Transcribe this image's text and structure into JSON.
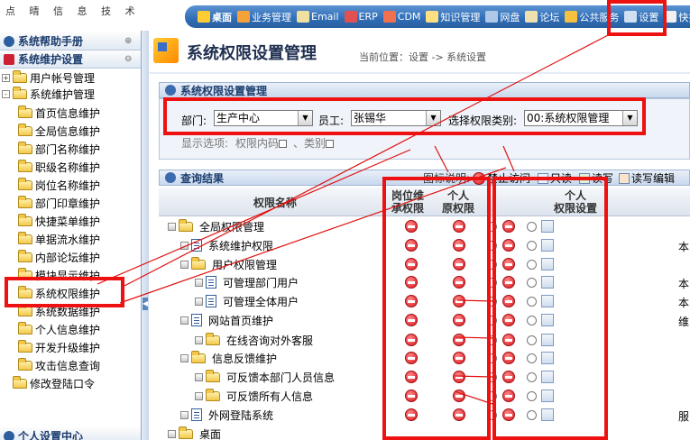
{
  "app": {
    "logo_text": "点 晴 信 息 技 术"
  },
  "menu": [
    {
      "label": "桌面",
      "icon": "desktop-icon",
      "color": "#ffcc33",
      "bold": true
    },
    {
      "label": "业务管理",
      "icon": "business-icon",
      "color": "#f6a23a"
    },
    {
      "label": "Email",
      "icon": "email-icon",
      "color": "#f0e0a0"
    },
    {
      "label": "ERP",
      "icon": "erp-icon",
      "color": "#e05050"
    },
    {
      "label": "CDM",
      "icon": "cdm-icon",
      "color": "#f07050"
    },
    {
      "label": "知识管理",
      "icon": "knowledge-icon",
      "color": "#ffe080"
    },
    {
      "label": "网盘",
      "icon": "netdisk-icon",
      "color": "#b0c8e8"
    },
    {
      "label": "论坛",
      "icon": "forum-icon",
      "color": "#f0e0b0"
    },
    {
      "label": "公共服务",
      "icon": "public-service-icon",
      "color": "#f6c040"
    },
    {
      "label": "设置",
      "icon": "settings-icon",
      "color": "#d0e0f0"
    },
    {
      "label": "快捷",
      "icon": "shortcut-icon",
      "color": "#f0f0f0"
    }
  ],
  "sidebar": {
    "sections": [
      "系统帮助手册",
      "系统维护设置",
      "个人设置中心"
    ],
    "tree": [
      {
        "label": "用户帐号管理",
        "level": 0,
        "expander": "+"
      },
      {
        "label": "系统维护管理",
        "level": 0,
        "expander": "-"
      },
      {
        "label": "首页信息维护",
        "level": 1
      },
      {
        "label": "全局信息维护",
        "level": 1
      },
      {
        "label": "部门名称维护",
        "level": 1
      },
      {
        "label": "职级名称维护",
        "level": 1
      },
      {
        "label": "岗位名称维护",
        "level": 1
      },
      {
        "label": "部门印章维护",
        "level": 1
      },
      {
        "label": "快捷菜单维护",
        "level": 1
      },
      {
        "label": "单据流水维护",
        "level": 1
      },
      {
        "label": "内部论坛维护",
        "level": 1
      },
      {
        "label": "模块显示维护",
        "level": 1
      },
      {
        "label": "系统权限维护",
        "level": 1,
        "selected": true
      },
      {
        "label": "系统数据维护",
        "level": 1
      },
      {
        "label": "个人信息维护",
        "level": 1
      },
      {
        "label": "开发升级维护",
        "level": 1
      },
      {
        "label": "攻击信息查询",
        "level": 1
      },
      {
        "label": "修改登陆口令",
        "level": 0
      }
    ]
  },
  "main": {
    "title": "系统权限设置管理",
    "breadcrumb": "当前位置：设置 -> 系统设置",
    "settings_panel_title": "系统权限设置管理",
    "filters": {
      "dept_label": "部门:",
      "dept_value": "生产中心",
      "staff_label": "员工:",
      "staff_value": "张锡华",
      "category_label": "选择权限类别:",
      "category_value": "00:系统权限管理"
    },
    "display_options": {
      "label": "显示选项:",
      "opt1": "权限内码",
      "opt2": "类别"
    },
    "results_title": "查询结果",
    "legend": {
      "label": "图标说明:",
      "items": [
        "禁止访问",
        "只读",
        "读写",
        "读写编辑"
      ]
    },
    "columns": {
      "name": "权限名称",
      "post_inherit_1": "岗位维",
      "post_inherit_2": "承权限",
      "personal_orig_1": "个人",
      "personal_orig_2": "原权限",
      "personal_set_1": "个人",
      "personal_set_2": "权限设置"
    },
    "rows": [
      {
        "name": "全局权限管理",
        "level": 0,
        "kind": "folder",
        "extra": ""
      },
      {
        "name": "系统维护权限",
        "level": 1,
        "kind": "file",
        "extra": "本"
      },
      {
        "name": "用户权限管理",
        "level": 1,
        "kind": "folder",
        "extra": ""
      },
      {
        "name": "可管理部门用户",
        "level": 2,
        "kind": "file",
        "extra": "本"
      },
      {
        "name": "可管理全体用户",
        "level": 2,
        "kind": "file",
        "extra": "本"
      },
      {
        "name": "网站首页维护",
        "level": 1,
        "kind": "file",
        "extra": "维"
      },
      {
        "name": "在线咨询对外客服",
        "level": 2,
        "kind": "folder",
        "extra": ""
      },
      {
        "name": "信息反馈维护",
        "level": 1,
        "kind": "folder",
        "extra": ""
      },
      {
        "name": "可反馈本部门人员信息",
        "level": 2,
        "kind": "folder",
        "extra": ""
      },
      {
        "name": "可反馈所有人信息",
        "level": 2,
        "kind": "folder",
        "extra": ""
      },
      {
        "name": "外网登陆系统",
        "level": 1,
        "kind": "file",
        "extra": "服"
      },
      {
        "name": "桌面",
        "level": 0,
        "kind": "folder",
        "extra": ""
      }
    ]
  }
}
